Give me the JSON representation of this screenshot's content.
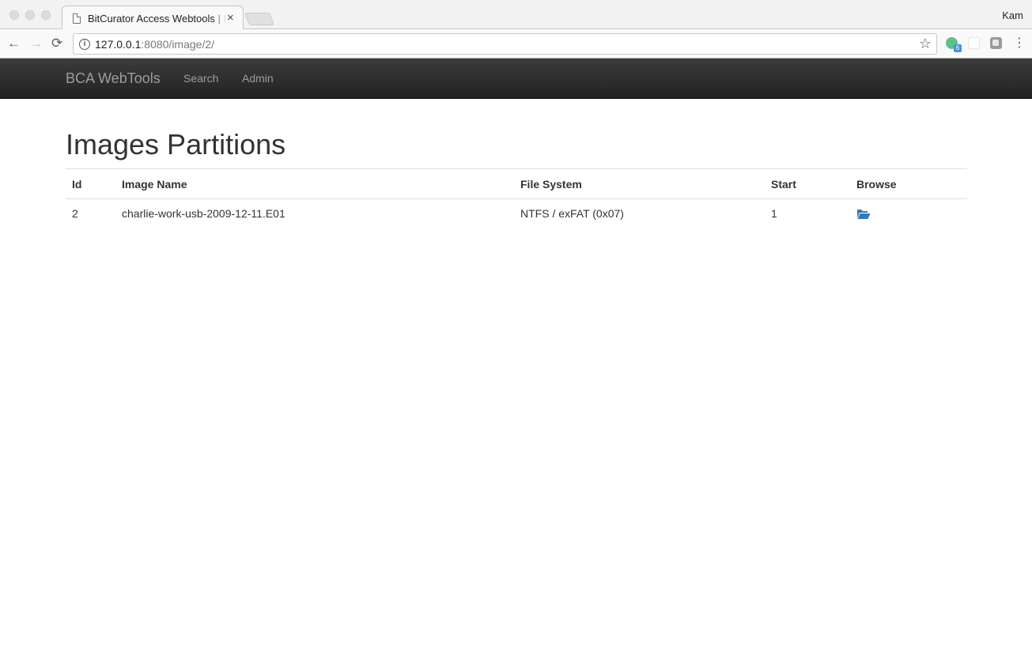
{
  "browser": {
    "tab_title": "BitCurator Access Webtools | Image Partitions",
    "tab_close": "×",
    "profile": "Kam",
    "url_host": "127.0.0.1",
    "url_rest": ":8080/image/2/",
    "extension_badge": "6",
    "icons": {
      "back": "←",
      "forward": "→",
      "reload": "⟳",
      "info": "i",
      "star": "☆",
      "menu": "⋮"
    }
  },
  "navbar": {
    "brand": "BCA WebTools",
    "links": [
      "Search",
      "Admin"
    ],
    "background": "#222222",
    "link_color": "#9d9d9d"
  },
  "main": {
    "title": "Images Partitions",
    "table": {
      "headers": [
        "Id",
        "Image Name",
        "File System",
        "Start",
        "Browse"
      ],
      "rows": [
        {
          "id": "2",
          "image_name": "charlie-work-usb-2009-12-11.E01",
          "file_system": "NTFS / exFAT (0x07)",
          "start": "1",
          "browse_icon": "folder-open-icon"
        }
      ]
    },
    "accent_color": "#337ab7"
  }
}
